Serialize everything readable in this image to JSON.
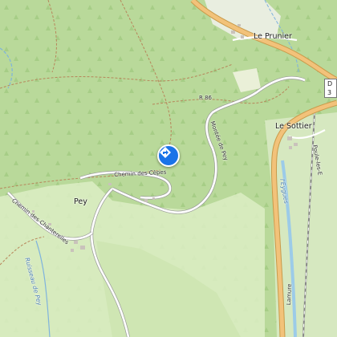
{
  "map": {
    "places": {
      "le_prunier": "Le Prunier",
      "le_sottier": "Le Sottier",
      "pey": "Pey"
    },
    "roads": {
      "r86": "R 86",
      "chemin_des_cepes": "Chemin des Cèpes",
      "montee_de_pey": "Montée de Pey",
      "chemin_des_chanterelles": "Chemin des Chanterelles",
      "poulet": "Poule-les-E",
      "shield_d": "D 3",
      "lamure": "Lamure"
    },
    "water": {
      "les_egues": "l'Eygues",
      "ruisseau_de_pey": "Ruisseau de Pey"
    },
    "marker": {
      "icon": "directions-icon",
      "color": "#1a73e8"
    },
    "colors": {
      "forest": "#b9d99a",
      "meadow": "#dcedc4",
      "main_road": "#f2c27a",
      "river": "#9ccbe8"
    }
  }
}
